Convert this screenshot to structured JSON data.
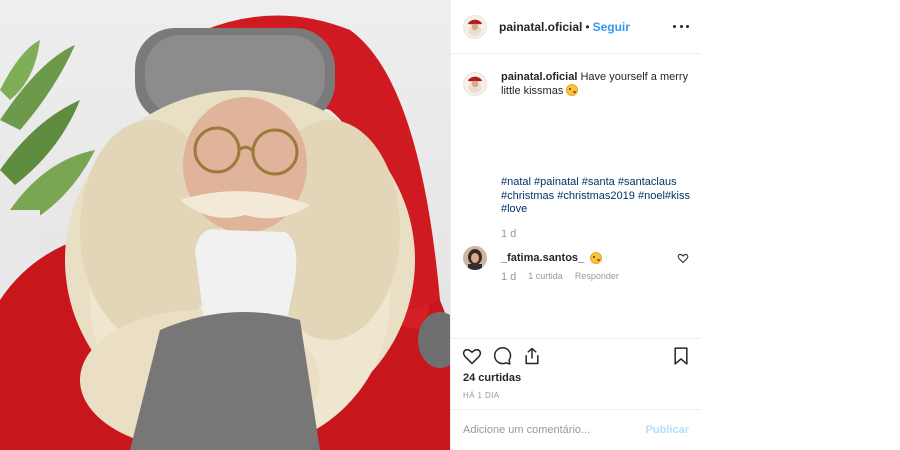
{
  "post": {
    "username": "painatal.oficial",
    "dot": "•",
    "follow_label": "Seguir",
    "caption_text": "Have yourself a merry little kissmas",
    "hashtags": [
      "#natal",
      "#painatal",
      "#santa",
      "#santaclaus",
      "#christmas",
      "#christmas2019",
      "#noel#kiss",
      "#love"
    ],
    "caption_age": "1 d"
  },
  "comment": {
    "username": "_fatima.santos_",
    "age": "1 d",
    "likes": "1 curtida",
    "reply_label": "Responder"
  },
  "engagement": {
    "likes_text": "24 curtidas",
    "timestamp": "HÁ 1 DIA"
  },
  "add_comment": {
    "placeholder": "Adicione um comentário...",
    "publish_label": "Publicar"
  },
  "icons": {
    "options": "more-dots-icon",
    "like": "heart-icon",
    "comment": "comment-bubble-icon",
    "share": "share-icon",
    "save": "bookmark-icon",
    "comment_like": "small-heart-icon"
  },
  "colors": {
    "link_blue": "#3897f0",
    "hashtag_blue": "#003569",
    "publish_disabled": "#b2dffc",
    "santa_red": "#c8161d"
  }
}
